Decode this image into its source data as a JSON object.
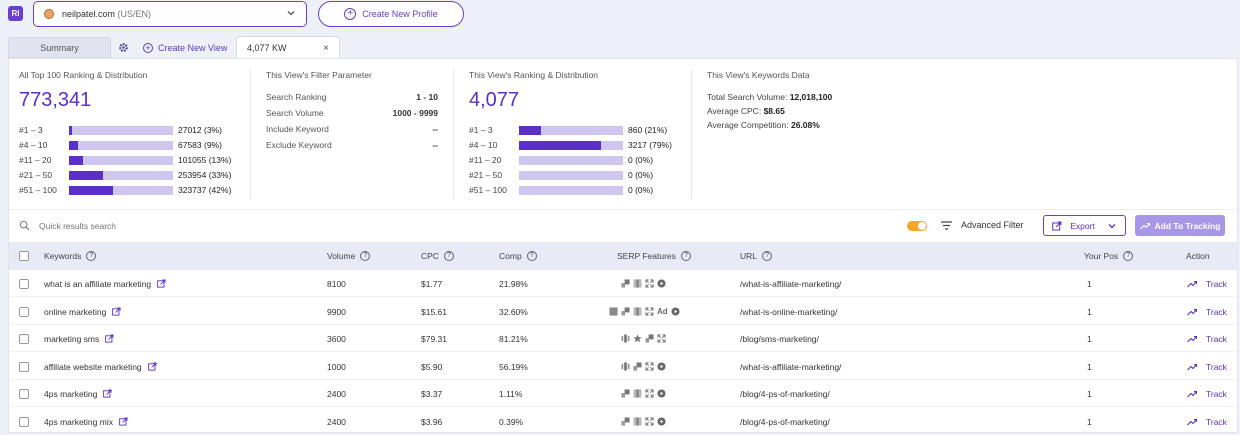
{
  "topbar": {
    "logo_text": "RI",
    "domain": "neilpatel.com",
    "domain_locale": "(US/EN)",
    "new_profile_label": "Create New Profile"
  },
  "tabs": {
    "summary": "Summary",
    "new_view": "Create New View",
    "active": "4,077 KW"
  },
  "stats": {
    "all_top": {
      "title": "All Top 100 Ranking & Distribution",
      "total": "773,341",
      "rows": [
        {
          "label": "#1 – 3",
          "value": "27012 (3%)",
          "pct": 3
        },
        {
          "label": "#4 – 10",
          "value": "67583 (9%)",
          "pct": 9
        },
        {
          "label": "#11 – 20",
          "value": "101055 (13%)",
          "pct": 13
        },
        {
          "label": "#21 – 50",
          "value": "253954 (33%)",
          "pct": 33
        },
        {
          "label": "#51 – 100",
          "value": "323737 (42%)",
          "pct": 42
        }
      ]
    },
    "filter": {
      "title": "This View's Filter Parameter",
      "rows": [
        {
          "label": "Search Ranking",
          "value": "1 - 10"
        },
        {
          "label": "Search Volume",
          "value": "1000 - 9999"
        },
        {
          "label": "Include Keyword",
          "value": "--"
        },
        {
          "label": "Exclude Keyword",
          "value": "--"
        }
      ]
    },
    "view": {
      "title": "This View's Ranking & Distribution",
      "total": "4,077",
      "rows": [
        {
          "label": "#1 – 3",
          "value": "860 (21%)",
          "pct": 21
        },
        {
          "label": "#4 – 10",
          "value": "3217 (79%)",
          "pct": 79
        },
        {
          "label": "#11 – 20",
          "value": "0 (0%)",
          "pct": 0
        },
        {
          "label": "#21 – 50",
          "value": "0 (0%)",
          "pct": 0
        },
        {
          "label": "#51 – 100",
          "value": "0 (0%)",
          "pct": 0
        }
      ]
    },
    "keywords": {
      "title": "This View's Keywords Data",
      "lines": [
        {
          "label": "Total Search Volume:",
          "value": "12,018,100"
        },
        {
          "label": "Average CPC:",
          "value": "$8.65"
        },
        {
          "label": "Average Competition:",
          "value": "26.08%"
        }
      ]
    }
  },
  "toolbar": {
    "search_placeholder": "Quick results search",
    "advanced_filter": "Advanced Filter",
    "export": "Export",
    "add_tracking": "Add To Tracking",
    "toggle_color": "#f5a623"
  },
  "table": {
    "headers": {
      "keywords": "Keywords",
      "volume": "Volume",
      "cpc": "CPC",
      "comp": "Comp",
      "serp": "SERP Features",
      "url": "URL",
      "pos": "Your Pos",
      "action": "Action"
    },
    "track_label": "Track",
    "rows": [
      {
        "keyword": "what is an affiliate marketing",
        "volume": "8100",
        "cpc": "$1.77",
        "comp": "21.98%",
        "serp": [
          "related-icon",
          "snippet-icon",
          "expand-icon",
          "video-icon"
        ],
        "url": "/what-is-affiliate-marketing/",
        "pos": "1"
      },
      {
        "keyword": "online marketing",
        "volume": "9900",
        "cpc": "$15.61",
        "comp": "32.60%",
        "serp": [
          "image-icon",
          "related-icon",
          "snippet-icon",
          "expand-icon",
          "ad",
          "video-icon"
        ],
        "url": "/what-is-online-marketing/",
        "pos": "1"
      },
      {
        "keyword": "marketing sms",
        "volume": "3600",
        "cpc": "$79.31",
        "comp": "81.21%",
        "serp": [
          "news-icon",
          "star-icon",
          "related-icon",
          "expand-icon"
        ],
        "url": "/blog/sms-marketing/",
        "pos": "1"
      },
      {
        "keyword": "affiliate website marketing",
        "volume": "1000",
        "cpc": "$5.90",
        "comp": "56.19%",
        "serp": [
          "news-icon",
          "related-icon",
          "expand-icon",
          "video-icon"
        ],
        "url": "/what-is-affiliate-marketing/",
        "pos": "1"
      },
      {
        "keyword": "4ps marketing",
        "volume": "2400",
        "cpc": "$3.37",
        "comp": "1.11%",
        "serp": [
          "related-icon",
          "snippet-icon",
          "expand-icon",
          "video-icon"
        ],
        "url": "/blog/4-ps-of-marketing/",
        "pos": "1"
      },
      {
        "keyword": "4ps marketing mix",
        "volume": "2400",
        "cpc": "$3.96",
        "comp": "0.39%",
        "serp": [
          "related-icon",
          "snippet-icon",
          "expand-icon",
          "video-icon"
        ],
        "url": "/blog/4-ps-of-marketing/",
        "pos": "1"
      }
    ]
  }
}
